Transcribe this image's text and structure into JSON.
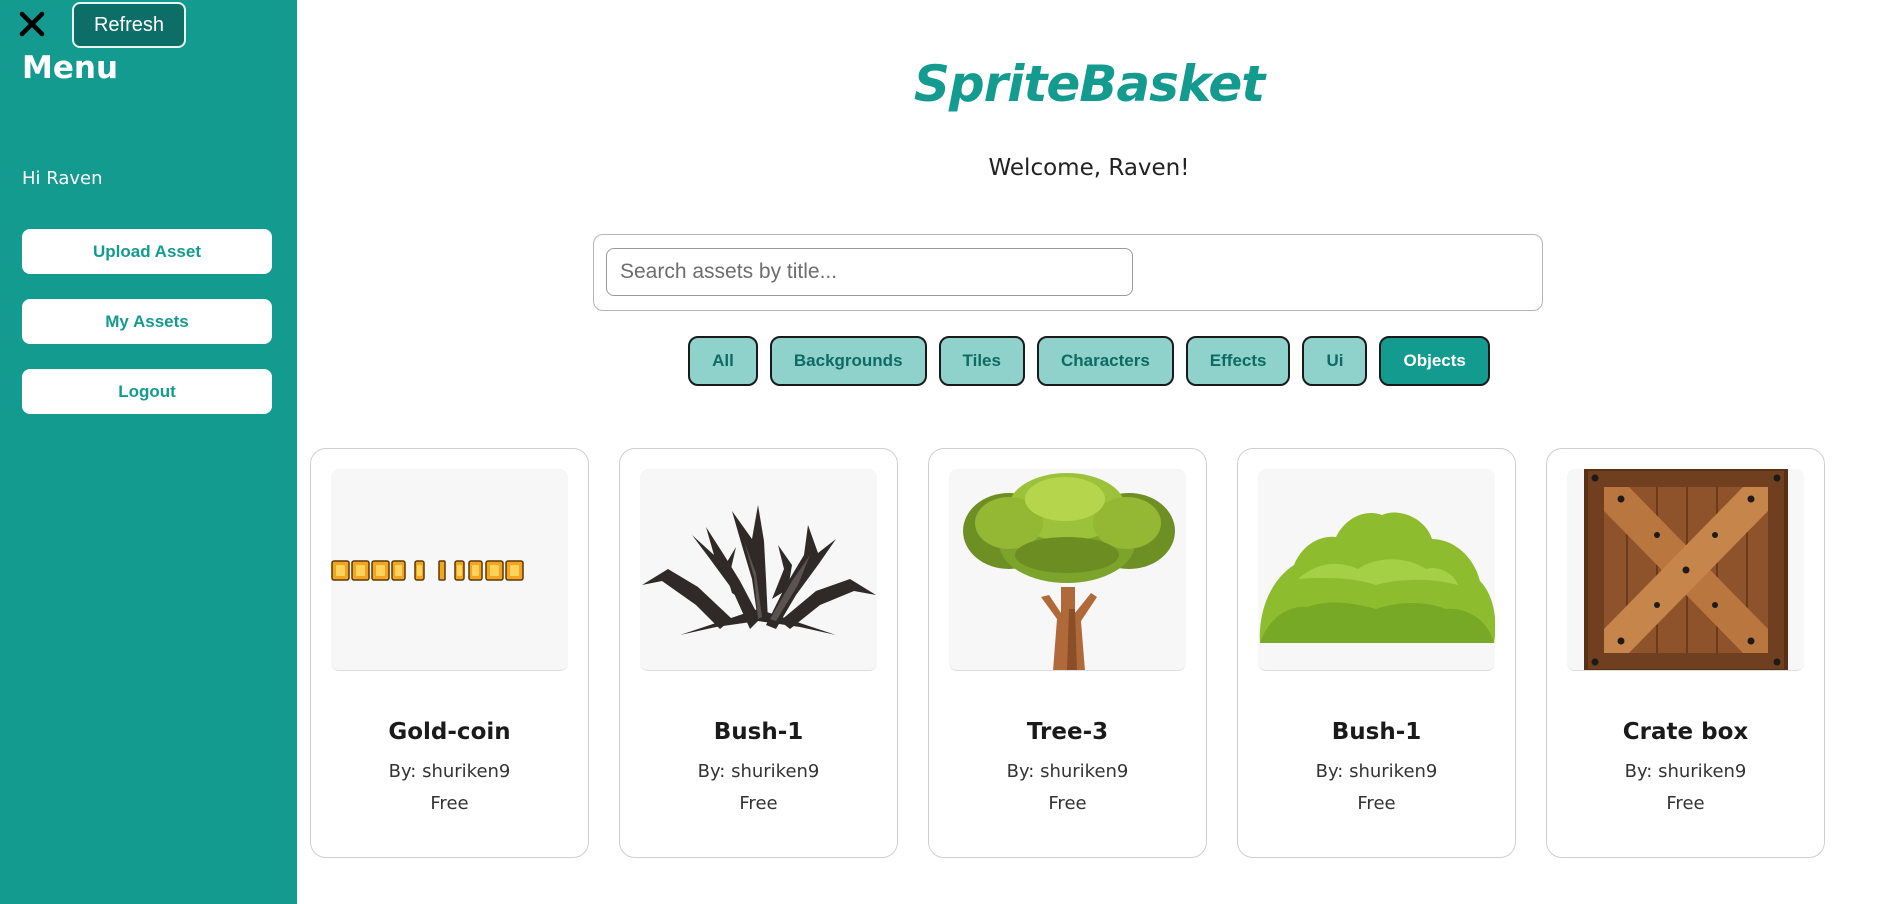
{
  "sidebar": {
    "close_icon": "close-icon",
    "refresh_label": "Refresh",
    "menu_title": "Menu",
    "greeting": "Hi Raven",
    "buttons": [
      "Upload Asset",
      "My Assets",
      "Logout"
    ]
  },
  "main": {
    "brand": "SpriteBasket",
    "welcome": "Welcome, Raven!",
    "search": {
      "placeholder": "Search assets by title...",
      "value": ""
    },
    "filters": [
      "All",
      "Backgrounds",
      "Tiles",
      "Characters",
      "Effects",
      "Ui",
      "Objects"
    ],
    "active_filter": "Objects",
    "assets": [
      {
        "title": "Gold-coin",
        "author": "By: shuriken9",
        "price": "Free",
        "image": "gold-coin-sprite-strip"
      },
      {
        "title": "Bush-1",
        "author": "By: shuriken9",
        "price": "Free",
        "image": "dead-bush"
      },
      {
        "title": "Tree-3",
        "author": "By: shuriken9",
        "price": "Free",
        "image": "green-tree"
      },
      {
        "title": "Bush-1",
        "author": "By: shuriken9",
        "price": "Free",
        "image": "green-bush"
      },
      {
        "title": "Crate box",
        "author": "By: shuriken9",
        "price": "Free",
        "image": "wooden-crate"
      }
    ]
  },
  "colors": {
    "accent": "#149b90",
    "accent_dark": "#0c6e66",
    "chip_bg": "#8fd2cb"
  }
}
